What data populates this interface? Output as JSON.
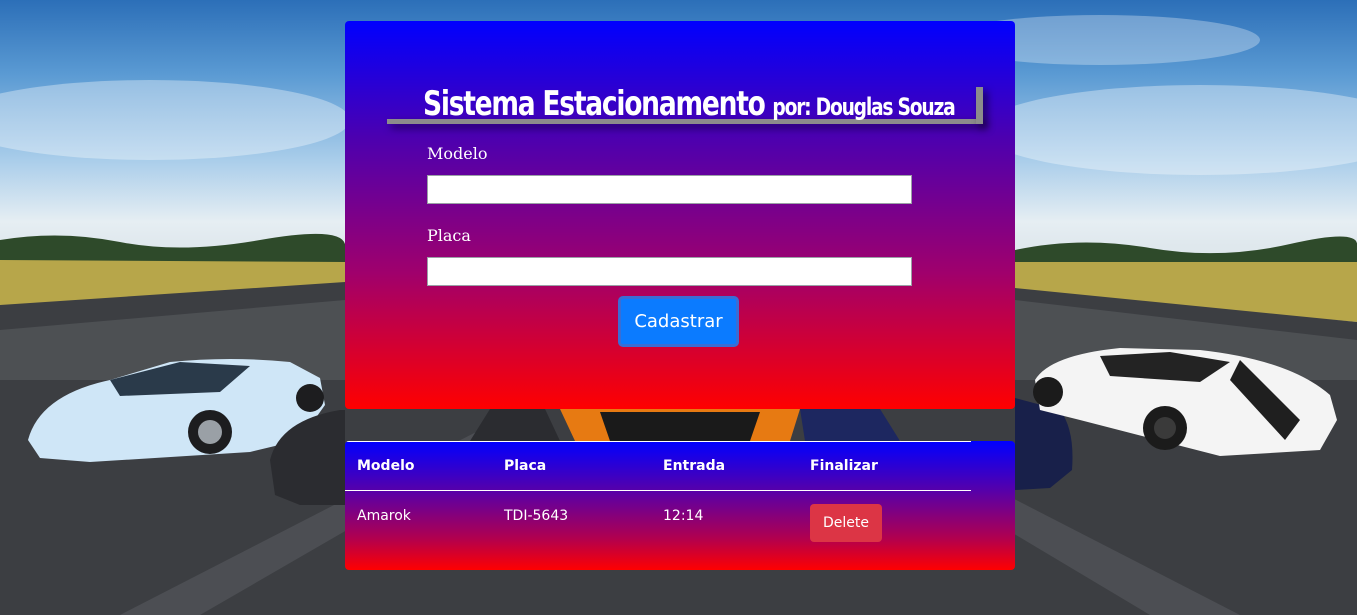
{
  "header": {
    "title": "Sistema Estacionamento",
    "subtitle": "por: Douglas Souza"
  },
  "form": {
    "modelo_label": "Modelo",
    "modelo_value": "",
    "placa_label": "Placa",
    "placa_value": "",
    "submit_label": "Cadastrar"
  },
  "table": {
    "columns": [
      "Modelo",
      "Placa",
      "Entrada",
      "Finalizar"
    ],
    "rows": [
      {
        "modelo": "Amarok",
        "placa": "TDI-5643",
        "entrada": "12:14",
        "action_label": "Delete"
      }
    ]
  },
  "colors": {
    "primary_button": "#0b7bff",
    "delete_button": "#dc3545",
    "gradient_top": "#0000ff",
    "gradient_bottom": "#ff0000"
  }
}
